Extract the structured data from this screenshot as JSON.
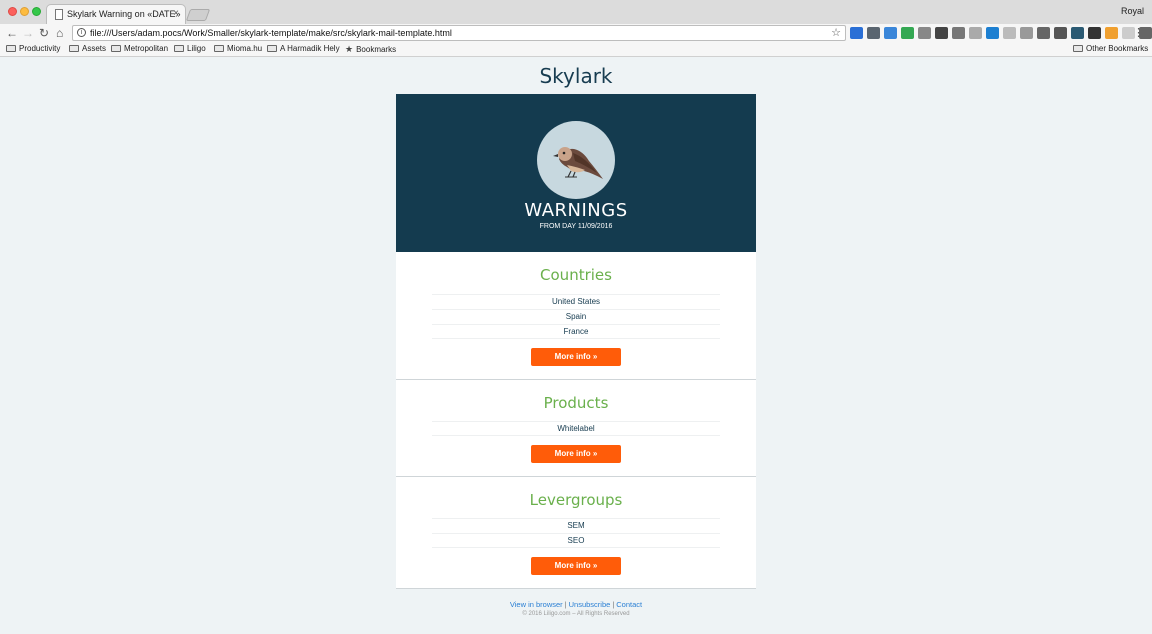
{
  "browser": {
    "tab_title": "Skylark Warning on «DATE»",
    "tab_close": "×",
    "profile_name": "Royal",
    "url": "file:///Users/adam.pocs/Work/Smaller/skylark-template/make/src/skylark-mail-template.html",
    "bookmarks": [
      "Productivity",
      "Assets",
      "Metropolitan",
      "Liligo",
      "Mioma.hu",
      "A Harmadik Hely",
      "Bookmarks"
    ],
    "other_bookmarks": "Other Bookmarks"
  },
  "page": {
    "title": "Skylark",
    "hero": {
      "title": "WARNINGS",
      "subtitle": "FROM DAY 11/09/2016"
    },
    "sections": [
      {
        "title": "Countries",
        "items": [
          "United States",
          "Spain",
          "France"
        ],
        "button": "More info »"
      },
      {
        "title": "Products",
        "items": [
          "Whitelabel"
        ],
        "button": "More info »"
      },
      {
        "title": "Levergroups",
        "items": [
          "SEM",
          "SEO"
        ],
        "button": "More info »"
      }
    ],
    "footer": {
      "links": [
        "View in browser",
        "Unsubscribe",
        "Contact"
      ],
      "separator": "|",
      "copyright": "© 2016 Liligo.com – All Rights Reserved"
    }
  },
  "colors": {
    "hero_bg": "#143b4f",
    "section_title": "#6ab04c",
    "button_bg": "#ff5c09",
    "link": "#2a7fd4"
  }
}
